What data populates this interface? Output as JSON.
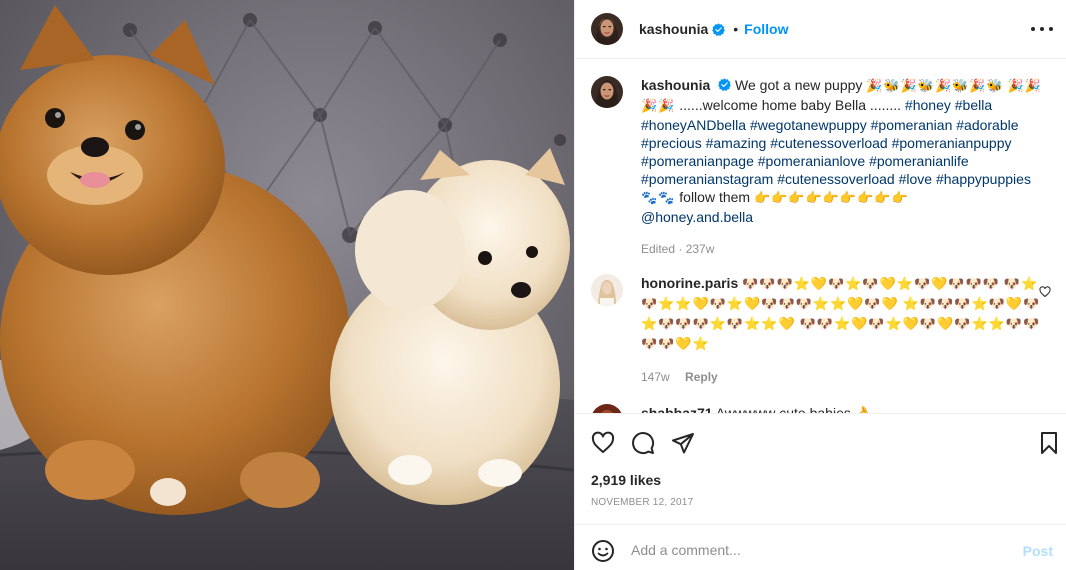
{
  "post": {
    "username": "kashounia",
    "follow_label": "Follow",
    "dot": "•",
    "image_alt": "Two Pomeranian puppies on a grey tufted sofa"
  },
  "caption": {
    "username": "kashounia",
    "text_1": "We got a new puppy",
    "emoji_1": "🎉🐝🎉🐝🎉🐝🎉🐝",
    "emoji_2": "🎉🎉🎉🎉",
    "text_2": "......welcome home baby Bella ........",
    "hashtags": [
      "#honey",
      "#bella",
      "#honeyANDbella",
      "#wegotanewpuppy",
      "#pomeranian",
      "#adorable",
      "#precious",
      "#amazing",
      "#cutenessoverload",
      "#pomeranianpuppy",
      "#pomeranianpage",
      "#pomeranianlove",
      "#pomeranianlife",
      "#pomeranianstagram",
      "#cutenessoverload",
      "#love",
      "#happypuppies"
    ],
    "paws": "🐾🐾",
    "follow_text": "follow them",
    "pointers": "👉👉👉👉👉👉👉👉👉",
    "mention": "@honey.and.bella",
    "edited": "Edited · 237w"
  },
  "comments": [
    {
      "username": "honorine.paris",
      "lines": [
        "🐶🐶🐶⭐💛🐶⭐🐶💛⭐🐶💛🐶🐶🐶",
        "🐶⭐🐶⭐⭐💛🐶⭐💛🐶🐶🐶⭐⭐💛🐶💛",
        "⭐🐶🐶🐶⭐🐶💛🐶⭐🐶🐶🐶⭐🐶⭐⭐💛",
        "🐶🐶⭐💛🐶⭐💛🐶💛🐶⭐⭐🐶🐶🐶🐶💛⭐"
      ],
      "age": "147w",
      "reply_label": "Reply"
    },
    {
      "username": "shabbaz71",
      "text": "Awwwww cute babies 👌"
    }
  ],
  "likes": "2,919 likes",
  "date": "NOVEMBER 12, 2017",
  "add_comment": {
    "placeholder": "Add a comment...",
    "post_label": "Post"
  },
  "icons": {
    "like": "heart-icon",
    "comment": "comment-icon",
    "share": "paper-plane-icon",
    "save": "bookmark-icon",
    "emoji": "smiley-icon",
    "more": "more-options-icon",
    "verified": "verified-badge-icon"
  },
  "colors": {
    "accent": "#0095f6",
    "hashtag": "#00376b",
    "muted": "#8e8e8e",
    "post_disabled": "#b2dffc"
  }
}
